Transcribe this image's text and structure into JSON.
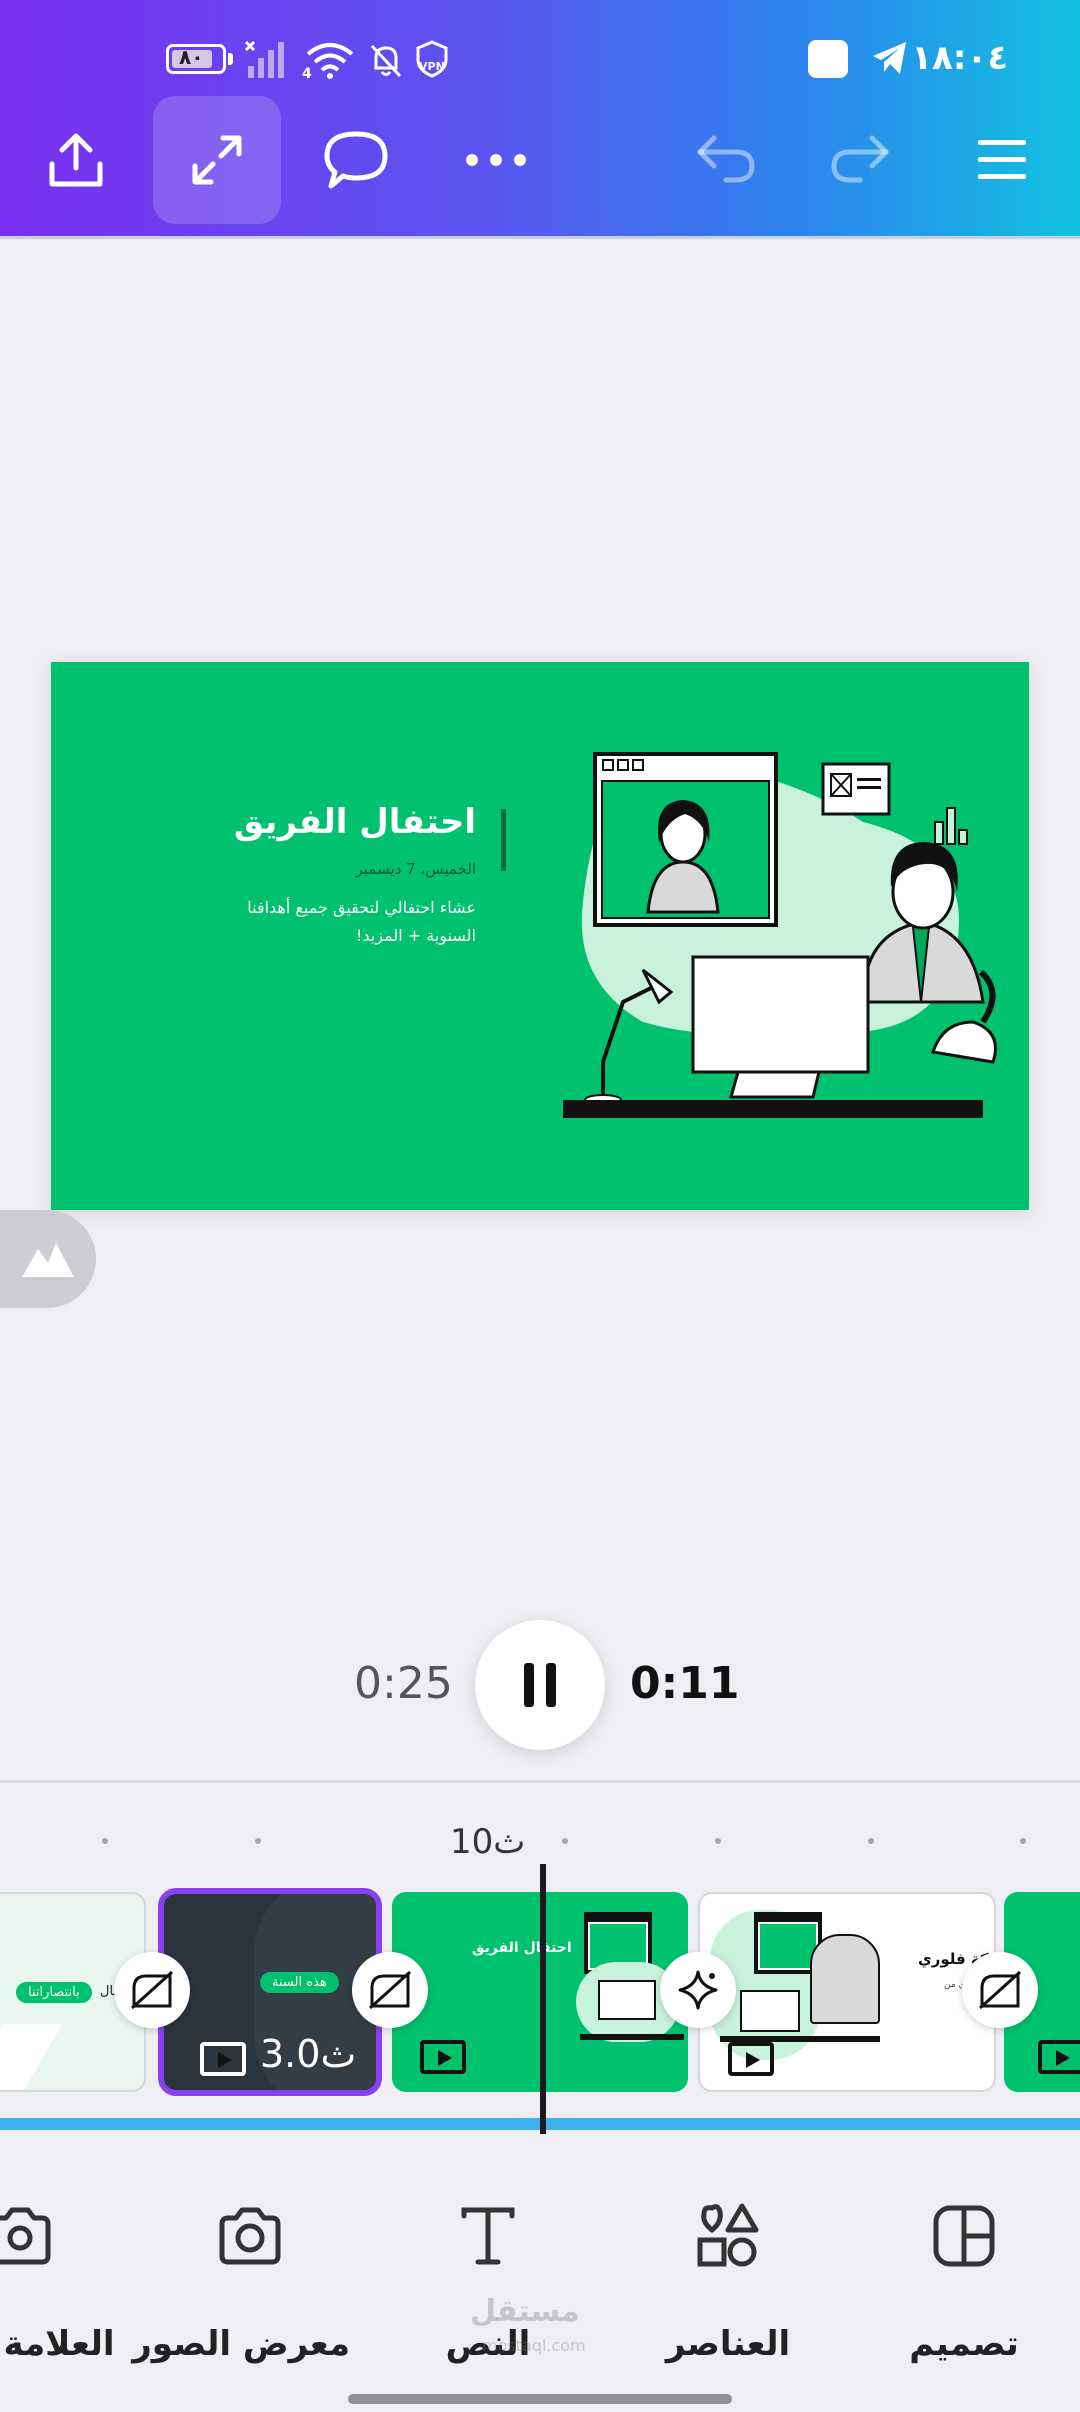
{
  "status_bar": {
    "time": "١٨:٠٤",
    "battery": "٨٠"
  },
  "toolbar": {
    "export_icon": "share-upload-icon",
    "expand_icon": "expand-arrows-icon",
    "comment_icon": "comment-bubble-icon",
    "more_icon": "more-dots-icon",
    "undo_icon": "undo-icon",
    "redo_icon": "redo-icon",
    "menu_icon": "hamburger-menu-icon"
  },
  "slide": {
    "title": "احتفال الفريق",
    "date": "الخميس، 7 ديسمبر",
    "description": "عشاء احتفالي لتحقيق جميع أهدافنا السنوية + المزيد!",
    "background": "#00c16e"
  },
  "playback": {
    "total_time": "0:25",
    "current_time": "0:11"
  },
  "timeline": {
    "ruler_label": "10ث",
    "thumbnails": [
      {
        "tag": "بانتصاراتنا",
        "partial": "فال"
      },
      {
        "tag": "هذه السنة",
        "duration": "3.0ث"
      },
      {
        "title": "احتفال الفريق"
      },
      {
        "title": "حركة فلوري",
        "subtitle": "أي من"
      },
      {
        "title": ""
      }
    ],
    "accent": "#8b3ff2",
    "progress_color": "#3fb0ee"
  },
  "bottom_nav": {
    "design": "تصميم",
    "elements": "العناصر",
    "text": "النص",
    "gallery": "معرض الصور",
    "brand": "العلامة ا"
  },
  "watermark": {
    "ar": "مستقل",
    "en": "mostaql.com"
  }
}
